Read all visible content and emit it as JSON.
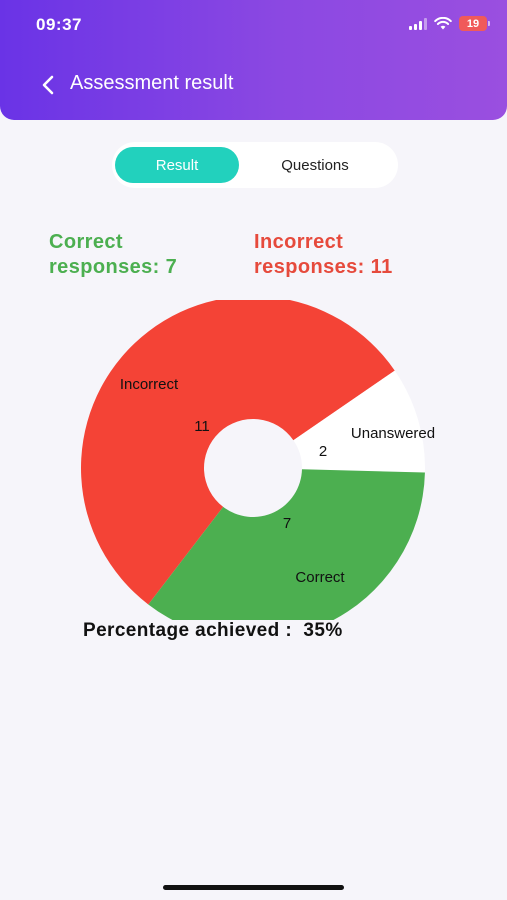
{
  "status_bar": {
    "time": "09:37",
    "battery": "19"
  },
  "header": {
    "title": "Assessment result"
  },
  "tabs": [
    {
      "label": "Result",
      "active": true
    },
    {
      "label": "Questions",
      "active": false
    }
  ],
  "summary": {
    "correct_line1": "Correct",
    "correct_line2": "responses: 7",
    "incorrect_line1": "Incorrect",
    "incorrect_line2": "responses: 11"
  },
  "chart_data": {
    "type": "pie",
    "slices": [
      {
        "label": "Incorrect",
        "value": 11,
        "color": "#f44336"
      },
      {
        "label": "Unanswered",
        "value": 2,
        "color": "#ffffff"
      },
      {
        "label": "Correct",
        "value": 7,
        "color": "#4caf50"
      }
    ]
  },
  "percentage": {
    "label": "Percentage achieved :",
    "value": "35%"
  },
  "colors": {
    "accent": "#22d1bd",
    "correct": "#4caf50",
    "incorrect": "#e64a3c",
    "header_start": "#6a33e6",
    "header_end": "#9a4fe0"
  }
}
